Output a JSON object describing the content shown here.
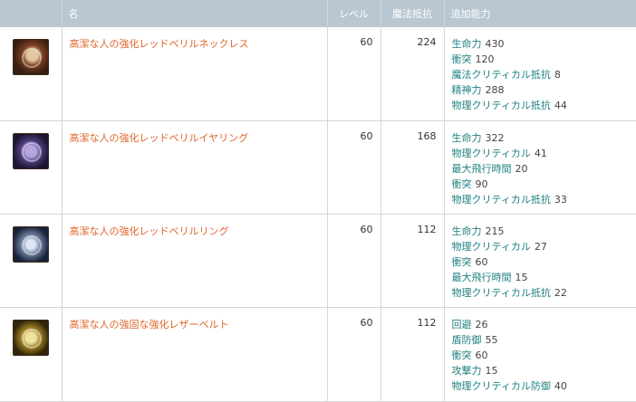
{
  "header": {
    "col_icon": "",
    "col_name": "名",
    "col_level": "レベル",
    "col_magic_resist": "魔法抵抗",
    "col_bonus": "追加能力"
  },
  "items": [
    {
      "icon": "necklace-icon",
      "name": "高潔な人の強化レッドベリルネックレス",
      "level": "60",
      "magic_resist": "224",
      "bonuses": [
        {
          "stat": "生命力",
          "value": "430"
        },
        {
          "stat": "衝突",
          "value": "120"
        },
        {
          "stat": "魔法クリティカル抵抗",
          "value": "8"
        },
        {
          "stat": "精神力",
          "value": "288"
        },
        {
          "stat": "物理クリティカル抵抗",
          "value": "44"
        }
      ]
    },
    {
      "icon": "earring-icon",
      "name": "高潔な人の強化レッドベリルイヤリング",
      "level": "60",
      "magic_resist": "168",
      "bonuses": [
        {
          "stat": "生命力",
          "value": "322"
        },
        {
          "stat": "物理クリティカル",
          "value": "41"
        },
        {
          "stat": "最大飛行時間",
          "value": "20"
        },
        {
          "stat": "衝突",
          "value": "90"
        },
        {
          "stat": "物理クリティカル抵抗",
          "value": "33"
        }
      ]
    },
    {
      "icon": "ring-icon",
      "name": "高潔な人の強化レッドベリルリング",
      "level": "60",
      "magic_resist": "112",
      "bonuses": [
        {
          "stat": "生命力",
          "value": "215"
        },
        {
          "stat": "物理クリティカル",
          "value": "27"
        },
        {
          "stat": "衝突",
          "value": "60"
        },
        {
          "stat": "最大飛行時間",
          "value": "15"
        },
        {
          "stat": "物理クリティカル抵抗",
          "value": "22"
        }
      ]
    },
    {
      "icon": "belt-icon",
      "name": "高潔な人の強固な強化レザーベルト",
      "level": "60",
      "magic_resist": "112",
      "bonuses": [
        {
          "stat": "回避",
          "value": "26"
        },
        {
          "stat": "盾防御",
          "value": "55"
        },
        {
          "stat": "衝突",
          "value": "60"
        },
        {
          "stat": "攻撃力",
          "value": "15"
        },
        {
          "stat": "物理クリティカル防御",
          "value": "40"
        }
      ]
    }
  ],
  "colors": {
    "header_bg": "#b9c7d2",
    "item_name": "#e0662b",
    "stat_name": "#1f8080"
  }
}
